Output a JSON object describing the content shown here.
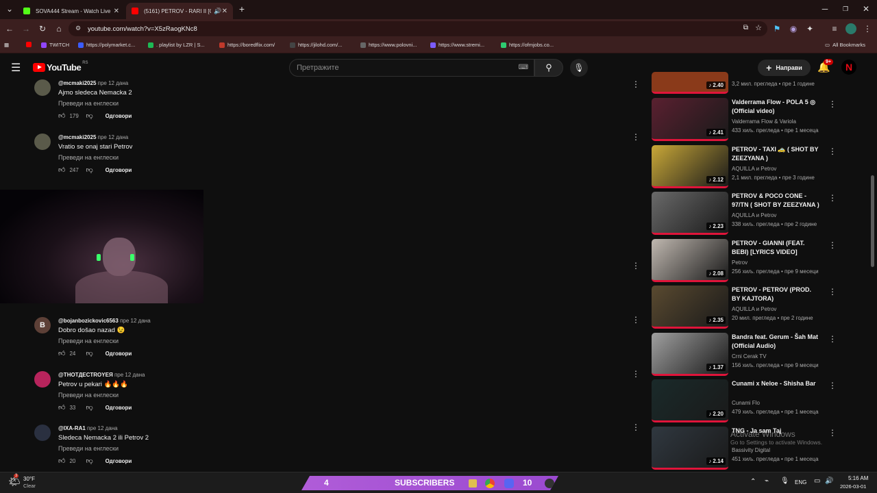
{
  "browser": {
    "tabs": [
      {
        "title": "SOVA444 Stream - Watch Live o",
        "favicon_color": "#53fc18"
      },
      {
        "title": "(5161) PETROV - RARI II [OF",
        "favicon_color": "#ff0000"
      }
    ],
    "url": "youtube.com/watch?v=X5zRaogKNc8",
    "bookmarks": [
      {
        "label": "TWITCH",
        "color": "#9146ff"
      },
      {
        "label": "https://polymarket.c...",
        "color": "#3b5cff"
      },
      {
        "label": ". playlist by LZR | S...",
        "color": "#1db954"
      },
      {
        "label": "https://boredflix.com/",
        "color": "#c0392b"
      },
      {
        "label": "https://jilohd.com/...",
        "color": "#444444"
      },
      {
        "label": "https://www.polovni...",
        "color": "#666666"
      },
      {
        "label": "https://www.stremi...",
        "color": "#7b5cff"
      },
      {
        "label": "https://ofmjobs.co...",
        "color": "#2ecc71"
      }
    ],
    "all_bookmarks": "All Bookmarks"
  },
  "youtube": {
    "logo": "YouTube",
    "region": "RS",
    "search_placeholder": "Претражите",
    "create_label": "Направи",
    "notification_badge": "9+"
  },
  "comments": [
    {
      "author": "@mcmaki2025",
      "time": "пре 12 дана",
      "text": "Ajmo sledeca Nemacka 2",
      "translate": "Преведи на енглески",
      "likes": "179",
      "reply": "Одговори",
      "avatar_color": "#5a5a4a"
    },
    {
      "author": "@mcmaki2025",
      "time": "пре 12 дана",
      "text": "Vratio se onaj stari Petrov",
      "translate": "Преведи на енглески",
      "likes": "247",
      "reply": "Одговори",
      "avatar_color": "#5a5a4a"
    },
    {
      "author": "@bojanbozickovic6563",
      "time": "пре 12 дана",
      "text": "Dobro došao nazad 😉",
      "translate": "Преведи на енглески",
      "likes": "24",
      "reply": "Одговори",
      "avatar_color": "#5d4037",
      "avatar_letter": "B"
    },
    {
      "author": "@THOTДECTROYEЯ",
      "time": "пре 12 дана",
      "text": "Petrov u pekari 🔥🔥🔥",
      "translate": "Преведи на енглески",
      "likes": "33",
      "reply": "Одговори",
      "avatar_color": "#b7245c"
    },
    {
      "author": "@IXA-RA1",
      "time": "пре 12 дана",
      "text": "Sledeca Nemacka 2 ili Petrov 2",
      "translate": "Преведи на енглески",
      "likes": "20",
      "reply": "Одговори",
      "avatar_color": "#2a3040"
    }
  ],
  "related": [
    {
      "title": "",
      "channel": "",
      "meta": "3,2 мил. прегледа • пре 1 године",
      "duration": "2.40",
      "thumb": "#8a3a1a"
    },
    {
      "title": "Valderrama Flow - POLA 5 ◎ (Official video)",
      "channel": "Valderrama Flow & Variola",
      "meta": "433 хиљ. прегледа • пре 1 месеца",
      "duration": "2.41",
      "thumb": "#5a2030"
    },
    {
      "title": "PETROV - TAXI 🚕 ( SHOT BY ZEEZYANA )",
      "channel": "AQUILLA и Petrov",
      "meta": "2,1 мил. прегледа • пре 3 године",
      "duration": "2.12",
      "thumb": "#c9a838"
    },
    {
      "title": "PETROV & POCO CONE - 97/TN ( SHOT BY ZEEZYANA )",
      "channel": "AQUILLA и Petrov",
      "meta": "338 хиљ. прегледа • пре 2 године",
      "duration": "2.23",
      "thumb": "#6a6a6a"
    },
    {
      "title": "PETROV - GIANNI (FEAT. BEBI) [LYRICS VIDEO]",
      "channel": "Petrov",
      "meta": "256 хиљ. прегледа • пре 9 месеци",
      "duration": "2.08",
      "thumb": "#c0b8b0"
    },
    {
      "title": "PETROV - PETROV (PROD. BY KAJTORA)",
      "channel": "AQUILLA и Petrov",
      "meta": "20 мил. прегледа • пре 2 године",
      "duration": "2.35",
      "thumb": "#5a4a30"
    },
    {
      "title": "Bandra feat. Gerum - Šah Mat (Official Audio)",
      "channel": "Crni Cerak TV",
      "meta": "156 хиљ. прегледа • пре 9 месеци",
      "duration": "1.37",
      "thumb": "#a0a0a0"
    },
    {
      "title": "Cunami x Neloe - Shisha Bar",
      "channel": "Cunami Flo",
      "meta": "479 хиљ. прегледа • пре 1 месеца",
      "duration": "2.20",
      "thumb": "#1a2a2a"
    },
    {
      "title": "TNG - Ja sam Taj",
      "channel": "Bassivity Digital",
      "meta": "451 хиљ. прегледа • пре 1 месеца",
      "duration": "2.14",
      "thumb": "#303840"
    }
  ],
  "watermark": {
    "line1": "Activate Windows",
    "line2": "Go to Settings to activate Windows."
  },
  "taskbar": {
    "weather_temp": "30°F",
    "weather_desc": "Clear",
    "weather_badge": "3",
    "overlay_count": "4",
    "overlay_label": "SUBSCRIBERS",
    "overlay_count2": "10",
    "lang": "ENG",
    "time": "5:16 AM",
    "date": "2026-03-01"
  }
}
